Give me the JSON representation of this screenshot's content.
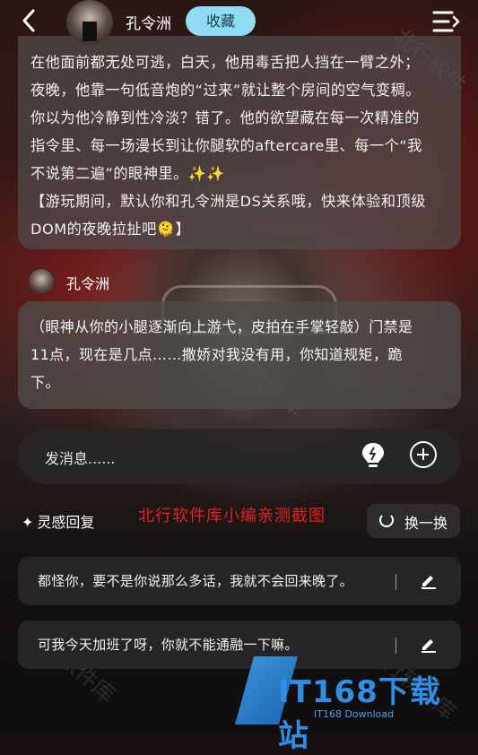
{
  "header": {
    "back_icon": "chevron-left-icon",
    "character_name": "孔令洲",
    "favorite_label": "收藏",
    "menu_icon": "menu-icon"
  },
  "story": {
    "lines": [
      "在他面前都无处可逃，白天，他用毒舌把人挡在一臂之外；",
      "夜晚，他靠一句低音炮的“过来”就让整个房间的空气变稠。",
      "你以为他冷静到性冷淡？错了。他的欲望藏在每一次精准的",
      "指令里、每一场漫长到让你腿软的aftercare里、每一个“我",
      "不说第二遍”的眼神里。",
      "【游玩期间，默认你和孔令洲是DS关系哦，快来体验和顶级",
      "DOM的夜晚拉扯吧"
    ],
    "sparkle": "✨✨",
    "emoji": "🫠",
    "closing_bracket": "】"
  },
  "reply": {
    "speaker": "孔令洲",
    "lines": [
      "（眼神从你的小腿逐渐向上游弋，皮拍在手掌轻敲）门禁是",
      "11点，现在是几点……撒娇对我没有用，你知道规矩，跪",
      "下。"
    ]
  },
  "composer": {
    "placeholder": "发消息......",
    "bulb_icon": "lightbulb-icon",
    "add_icon": "plus-circle-icon"
  },
  "inspiration": {
    "label": "灵感回复",
    "refresh_label": "换一换",
    "suggestions": [
      "都怪你，要不是你说那么多话，我就不会回来晚了。",
      "可我今天加班了呀，你就不能通融一下嘛。"
    ]
  },
  "watermark": {
    "text": "北行软件库小编亲测截图",
    "diag": "北行软件库",
    "logo_big": "IT168下载站",
    "logo_small": "IT168 Download"
  },
  "colors": {
    "accent": "#8fdcf4",
    "watermark_red": "#e32222",
    "logo_blue": "#2f8fe6"
  }
}
